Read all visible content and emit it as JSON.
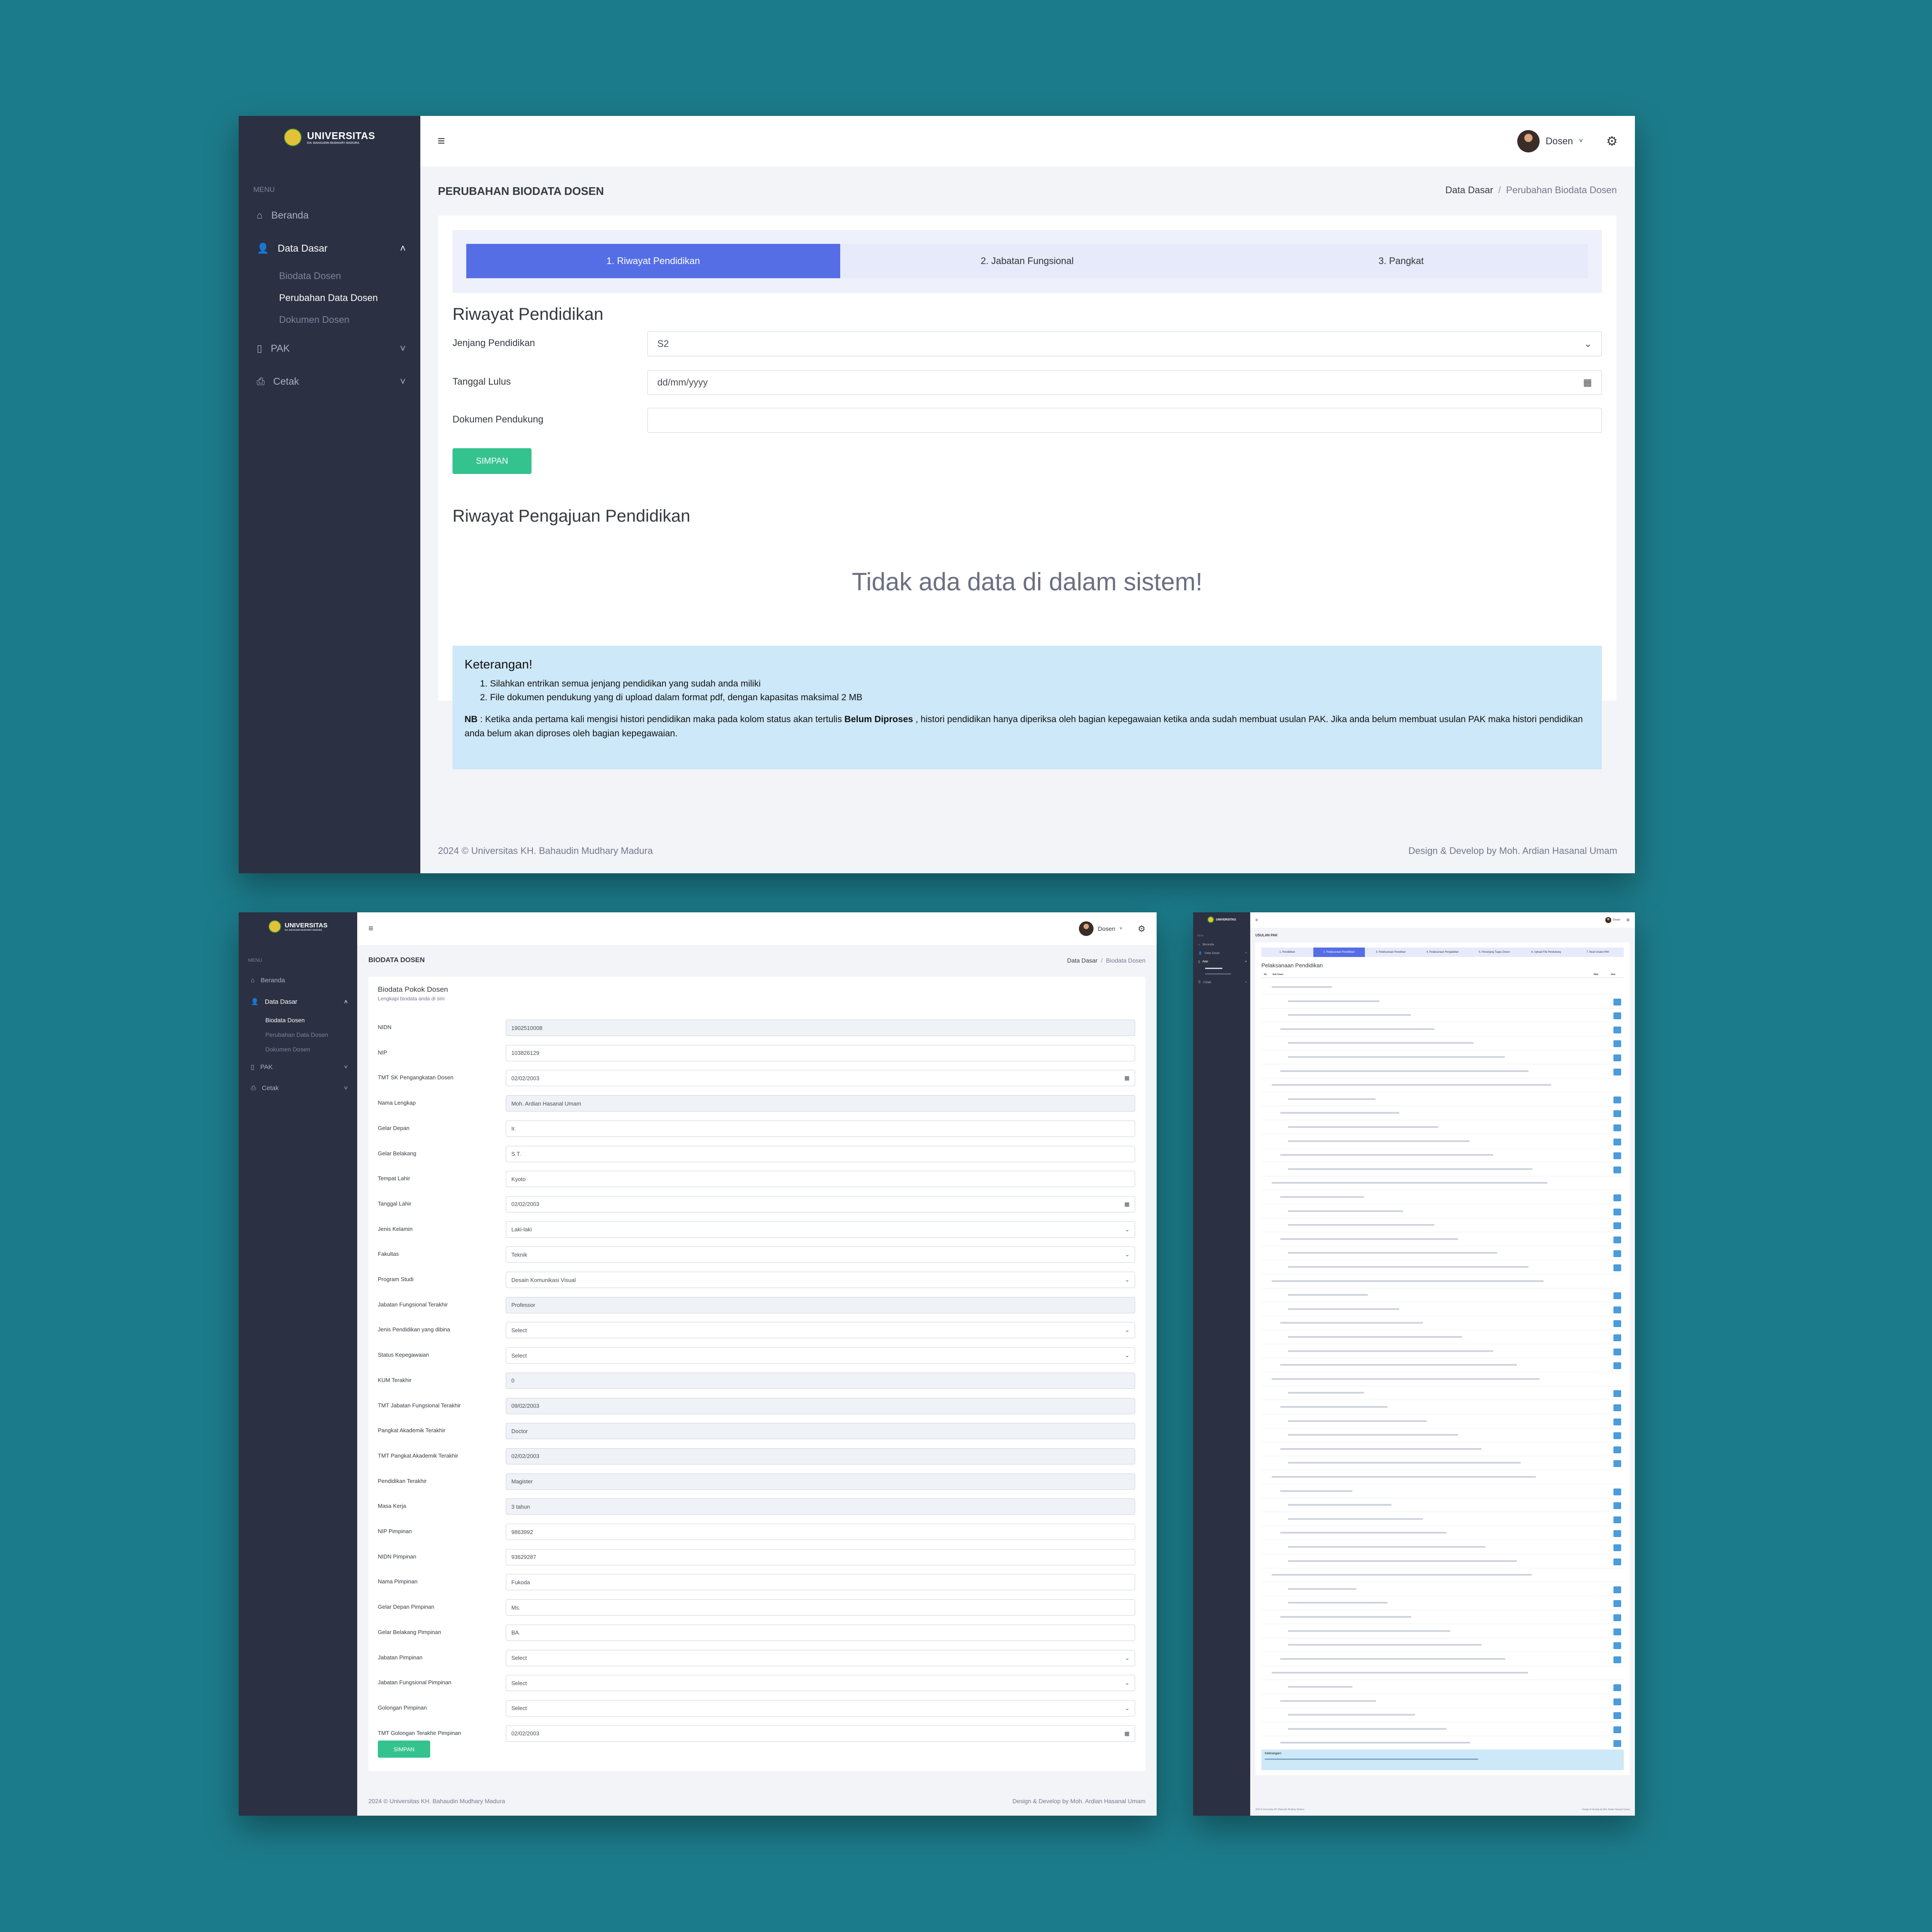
{
  "brand": {
    "name": "UNIVERSITAS",
    "sub": "KH. BAHAUDIN MUDHARY MADURA"
  },
  "menu": {
    "title": "MENU",
    "beranda": "Beranda",
    "data_dasar": "Data Dasar",
    "sub_items": [
      "Biodata Dosen",
      "Perubahan Data Dosen",
      "Dokumen Dosen"
    ],
    "pak": "PAK",
    "cetak": "Cetak"
  },
  "user": {
    "name": "Dosen"
  },
  "colors": {
    "sidebar": "#2b3042",
    "accent": "#556ee6",
    "success": "#34c38f",
    "info": "#cde8f8",
    "background": "#1c7b8a"
  },
  "s1": {
    "page_title": "PERUBAHAN BIODATA DOSEN",
    "breadcrumb": [
      "Data Dasar",
      "/",
      "Perubahan Biodata Dosen"
    ],
    "tabs": [
      "1. Riwayat Pendidikan",
      "2. Jabatan Fungsional",
      "3. Pangkat"
    ],
    "section_title": "Riwayat Pendidikan",
    "labels": [
      "Jenjang Pendidikan",
      "Tanggal Lulus",
      "Dokumen Pendukung"
    ],
    "values": {
      "jenjang": "S2",
      "tanggal": "dd/mm/yyyy",
      "dokumen": ""
    },
    "save": "SIMPAN",
    "history_title": "Riwayat Pengajuan Pendidikan",
    "empty": "Tidak ada data di dalam sistem!",
    "notes": {
      "title": "Keterangan!",
      "items": [
        "1. Silahkan entrikan semua jenjang pendidikan yang sudah anda miliki",
        "2. File dokumen pendukung yang di upload dalam format pdf, dengan kapasitas maksimal 2 MB"
      ],
      "nb_label": "NB",
      "nb_a": " : Ketika anda pertama kali mengisi histori pendidikan maka pada kolom status akan tertulis ",
      "nb_bold": "Belum Diproses",
      "nb_b": " , histori pendidikan hanya diperiksa oleh bagian kepegawaian ketika anda sudah membuat usulan PAK. Jika anda belum membuat usulan PAK maka histori pendidikan anda belum akan diproses oleh bagian kepegawaian."
    }
  },
  "footer": {
    "left": "2024 © Universitas KH. Bahaudin Mudhary Madura",
    "right": "Design & Develop by Moh. Ardian Hasanal Umam"
  },
  "s2": {
    "page_title": "BIODATA DOSEN",
    "breadcrumb": [
      "Data Dasar",
      "/",
      "Biodata Dosen"
    ],
    "card_title": "Biodata Pokok Dosen",
    "card_sub": "Lengkapi biodata anda di sini",
    "save": "SIMPAN",
    "fields": [
      {
        "label": "NIDN",
        "value": "1902510008",
        "kind": "ro"
      },
      {
        "label": "NIP",
        "value": "103826129",
        "kind": "txt"
      },
      {
        "label": "TMT SK Pengangkatan Dosen",
        "value": "02/02/2003",
        "kind": "date"
      },
      {
        "label": "Nama Lengkap",
        "value": "Moh. Ardian Hasanal Umam",
        "kind": "ro"
      },
      {
        "label": "Gelar Depan",
        "value": "Ir.",
        "kind": "txt"
      },
      {
        "label": "Gelar Belakang",
        "value": "S.T.",
        "kind": "txt"
      },
      {
        "label": "Tempat Lahir",
        "value": "Kyoto",
        "kind": "txt"
      },
      {
        "label": "Tanggal Lahir",
        "value": "02/02/2003",
        "kind": "date"
      },
      {
        "label": "Jenis Kelamin",
        "value": "Laki-laki",
        "kind": "sel"
      },
      {
        "label": "Fakultas",
        "value": "Teknik",
        "kind": "sel"
      },
      {
        "label": "Program Studi",
        "value": "Desain Komunikasi Visual",
        "kind": "sel"
      },
      {
        "label": "Jabatan Fungsional Terakhir",
        "value": "Professor",
        "kind": "ro"
      },
      {
        "label": "Jenis Pendidikan yang dibina",
        "value": "Select",
        "kind": "sel"
      },
      {
        "label": "Status Kepegawaian",
        "value": "Select",
        "kind": "sel"
      },
      {
        "label": "KUM Terakhir",
        "value": "0",
        "kind": "ro"
      },
      {
        "label": "TMT Jabatan Fungsional Terakhir",
        "value": "09/02/2003",
        "kind": "ro"
      },
      {
        "label": "Pangkat Akademik Terakhir",
        "value": "Doctor",
        "kind": "ro"
      },
      {
        "label": "TMT Pangkat Akademik Terakhir",
        "value": "02/02/2003",
        "kind": "ro"
      },
      {
        "label": "Pendidikan Terakhir",
        "value": "Magister",
        "kind": "ro"
      },
      {
        "label": "Masa Kerja",
        "value": "3 tahun",
        "kind": "ro"
      },
      {
        "label": "NIP Pimpinan",
        "value": "9863992",
        "kind": "txt"
      },
      {
        "label": "NIDN Pimpinan",
        "value": "93629287",
        "kind": "txt"
      },
      {
        "label": "Nama Pimpinan",
        "value": "Fukoda",
        "kind": "txt"
      },
      {
        "label": "Gelar Depan Pimpinan",
        "value": "Ms.",
        "kind": "txt"
      },
      {
        "label": "Gelar Belakang Pimpinan",
        "value": "BA.",
        "kind": "txt"
      },
      {
        "label": "Jabatan Pimpinan",
        "value": "Select",
        "kind": "sel"
      },
      {
        "label": "Jabatan Fungsional Pimpinan",
        "value": "Select",
        "kind": "sel"
      },
      {
        "label": "Golongan Pimpinan",
        "value": "Select",
        "kind": "sel"
      },
      {
        "label": "TMT Golongan Terakhir Pimpinan",
        "value": "02/02/2003",
        "kind": "date"
      }
    ]
  },
  "s3": {
    "page_title": "USULAN PAK",
    "tabs": [
      "1. Pendidikan",
      "2. Pelaksanaan Pendidikan",
      "3. Pelaksanaan Penelitian",
      "4. Pelaksanaan Pengabdian",
      "5. Penunjang Tugas Dosen",
      "6. Upload File Pendukung",
      "7. Buat Usulan PAK"
    ],
    "section_title": "Pelaksanaan Pendidikan",
    "table_head": [
      "No",
      "Sub Unsur",
      "Nilai",
      "Aksi"
    ],
    "notes_title": "Keterangan!"
  }
}
